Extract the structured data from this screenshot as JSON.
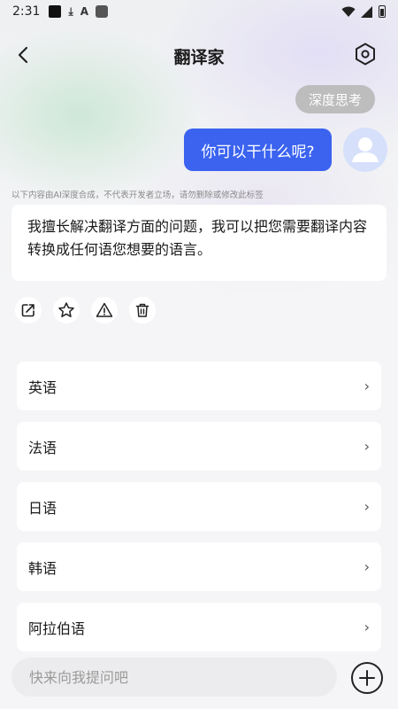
{
  "status_bar": {
    "time": "2:31",
    "icon_download": "⤓",
    "icon_a": "A"
  },
  "header": {
    "title": "翻译家"
  },
  "deep_think_label": "深度思考",
  "user_message": "你可以干什么呢?",
  "disclaimer": "以下内容由AI深度合成，不代表开发者立场，请勿删除或修改此标签",
  "ai_message": "我擅长解决翻译方面的问题，我可以把您需要翻译内容转换成任何语您想要的语言。",
  "options": [
    {
      "label": "英语"
    },
    {
      "label": "法语"
    },
    {
      "label": "日语"
    },
    {
      "label": "韩语"
    },
    {
      "label": "阿拉伯语"
    }
  ],
  "chevron": "›",
  "input": {
    "placeholder": "快来向我提问吧",
    "value": ""
  },
  "colors": {
    "accent": "#3b63f0",
    "deep_think_bg": "#bdbdbd",
    "avatar_bg": "#d6e0fb"
  }
}
